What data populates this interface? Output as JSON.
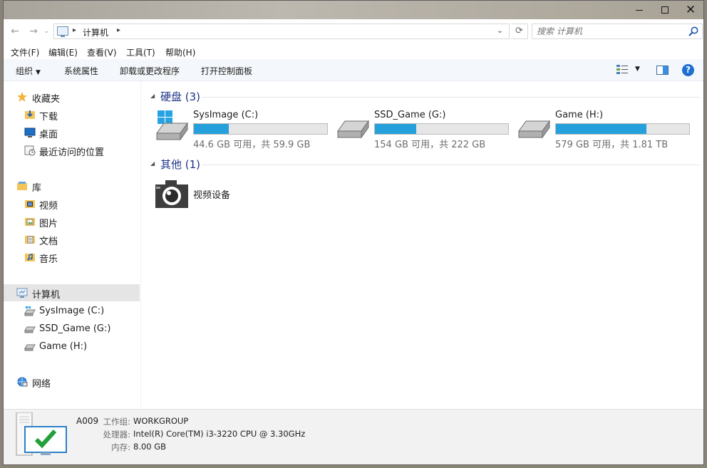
{
  "address": {
    "crumb": "计算机",
    "search_placeholder": "搜索 计算机"
  },
  "menu": [
    "文件(F)",
    "编辑(E)",
    "查看(V)",
    "工具(T)",
    "帮助(H)"
  ],
  "toolbar": {
    "organize": "组织",
    "system_properties": "系统属性",
    "uninstall": "卸载或更改程序",
    "control_panel": "打开控制面板"
  },
  "nav": {
    "favorites": {
      "label": "收藏夹",
      "items": [
        "下载",
        "桌面",
        "最近访问的位置"
      ]
    },
    "libraries": {
      "label": "库",
      "items": [
        "视频",
        "图片",
        "文档",
        "音乐"
      ]
    },
    "computer": {
      "label": "计算机",
      "items": [
        "SysImage (C:)",
        "SSD_Game (G:)",
        "Game (H:)"
      ]
    },
    "network": {
      "label": "网络"
    }
  },
  "groups": {
    "drives": {
      "title": "硬盘 (3)"
    },
    "other": {
      "title": "其他 (1)"
    }
  },
  "drives": [
    {
      "name": "SysImage (C:)",
      "info": "44.6 GB 可用，共 59.9 GB",
      "used_fraction": 0.26
    },
    {
      "name": "SSD_Game (G:)",
      "info": "154 GB 可用，共 222 GB",
      "used_fraction": 0.31
    },
    {
      "name": "Game (H:)",
      "info": "579 GB 可用，共 1.81 TB",
      "used_fraction": 0.68
    }
  ],
  "other_items": [
    {
      "name": "视频设备"
    }
  ],
  "details": {
    "computer_name": "A009",
    "workgroup_key": "工作组:",
    "workgroup_val": "WORKGROUP",
    "cpu_key": "处理器:",
    "cpu_val": "Intel(R) Core(TM) i3-3220 CPU @ 3.30GHz",
    "ram_key": "内存:",
    "ram_val": "8.00 GB"
  },
  "colors": {
    "accent": "#26a0da",
    "group_title": "#1e3287",
    "help": "#1e6fd0"
  }
}
